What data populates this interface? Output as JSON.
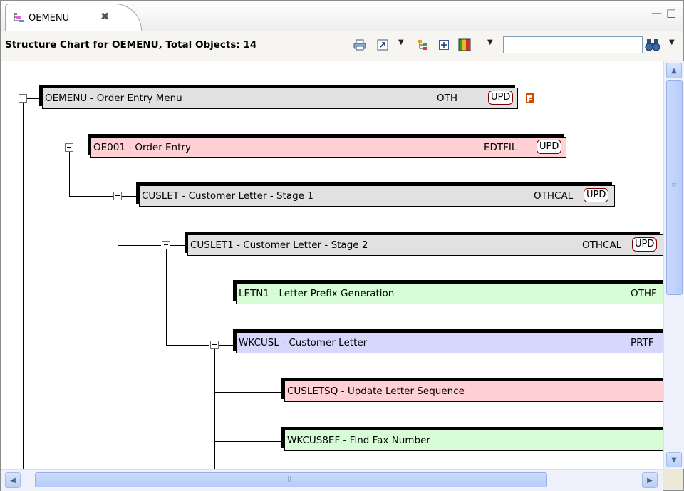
{
  "tab": {
    "label": "OEMENU",
    "close_glyph": "✖"
  },
  "window_controls": {
    "minimize": "—",
    "maximize": "□"
  },
  "toolbar": {
    "title": "Structure Chart for OEMENU, Total Objects: 14",
    "search_value": "",
    "icons": [
      "print-icon",
      "export-icon",
      "hierarchy-icon",
      "expand-all-icon",
      "color-legend-icon",
      "binoculars-icon"
    ]
  },
  "colors": {
    "gray": "#e1e1e1",
    "red": "#ffd0d4",
    "green": "#d6fdd5",
    "blue": "#d5d7fd",
    "upd_border": "#7b0000"
  },
  "nodes": [
    {
      "name": "OEMENU - Order Entry Menu",
      "type": "OTH",
      "badge": "UPD",
      "color": "gray",
      "has_note": true
    },
    {
      "name": "OE001 - Order Entry",
      "type": "EDTFIL",
      "badge": "UPD",
      "color": "red"
    },
    {
      "name": "CUSLET - Customer Letter - Stage 1",
      "type": "OTHCAL",
      "badge": "UPD",
      "color": "gray"
    },
    {
      "name": "CUSLET1 - Customer Letter - Stage 2",
      "type": "OTHCAL",
      "badge": "UPD",
      "color": "gray"
    },
    {
      "name": "LETN1 - Letter Prefix Generation",
      "type": "OTHF",
      "color": "green"
    },
    {
      "name": "WKCUSL - Customer Letter",
      "type": "PRTF",
      "color": "blue"
    },
    {
      "name": "CUSLETSQ - Update Letter Sequence",
      "type": "",
      "color": "red"
    },
    {
      "name": "WKCUS8EF - Find Fax Number",
      "type": "",
      "color": "green"
    }
  ],
  "scroll": {
    "h_grip": "|||",
    "v_grip": "≡"
  }
}
